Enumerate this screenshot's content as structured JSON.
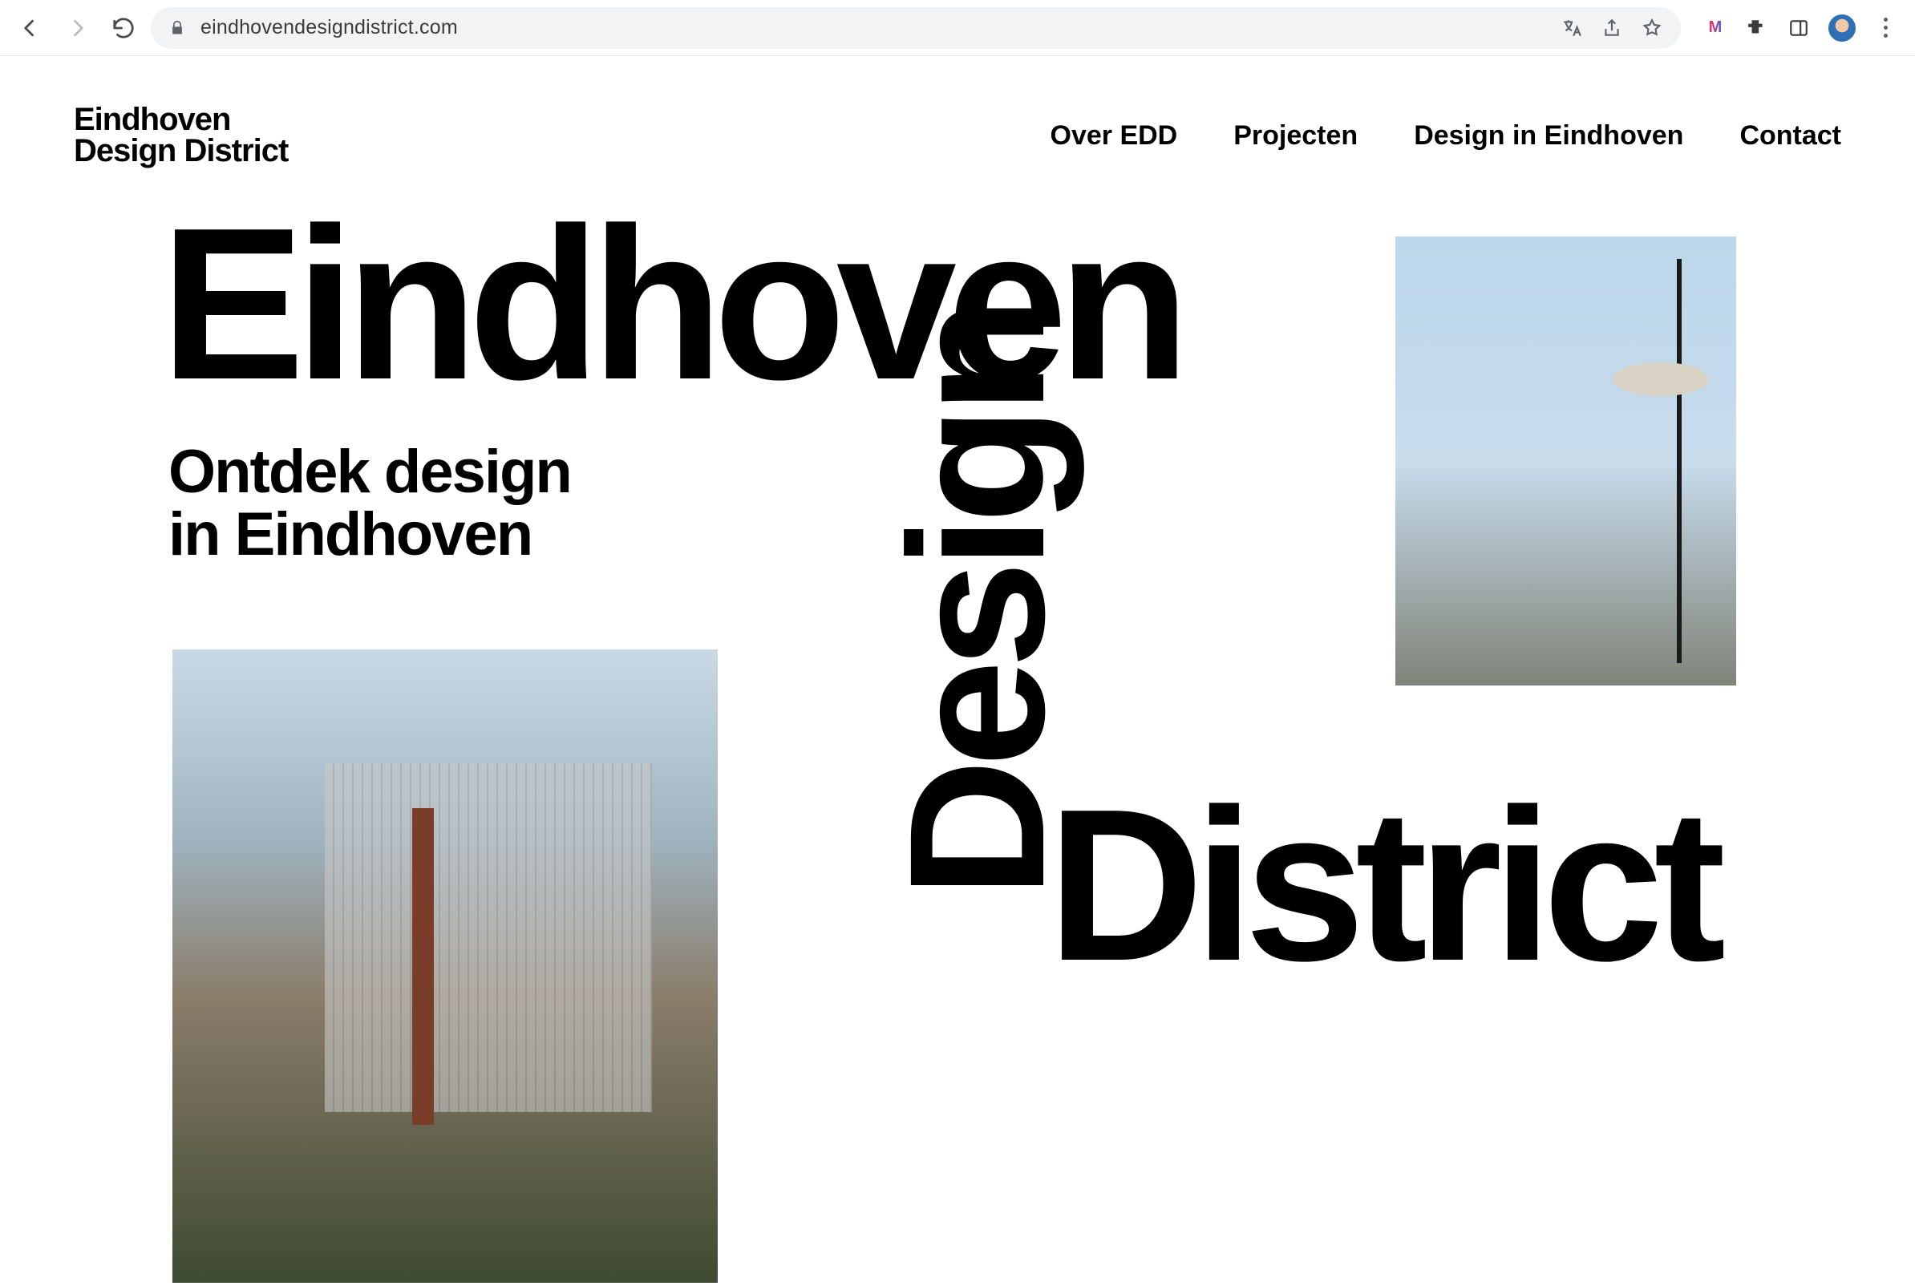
{
  "browser": {
    "url": "eindhovendesigndistrict.com"
  },
  "site": {
    "logo_line1": "Eindhoven",
    "logo_line2": "Design District",
    "nav": {
      "items": [
        {
          "label": "Over EDD"
        },
        {
          "label": "Projecten"
        },
        {
          "label": "Design in Eindhoven"
        },
        {
          "label": "Contact"
        }
      ]
    },
    "hero": {
      "word1": "Eindhoven",
      "sub_line1": "Ontdek design",
      "sub_line2": "in Eindhoven",
      "word2": "Design",
      "word3": "District"
    }
  }
}
